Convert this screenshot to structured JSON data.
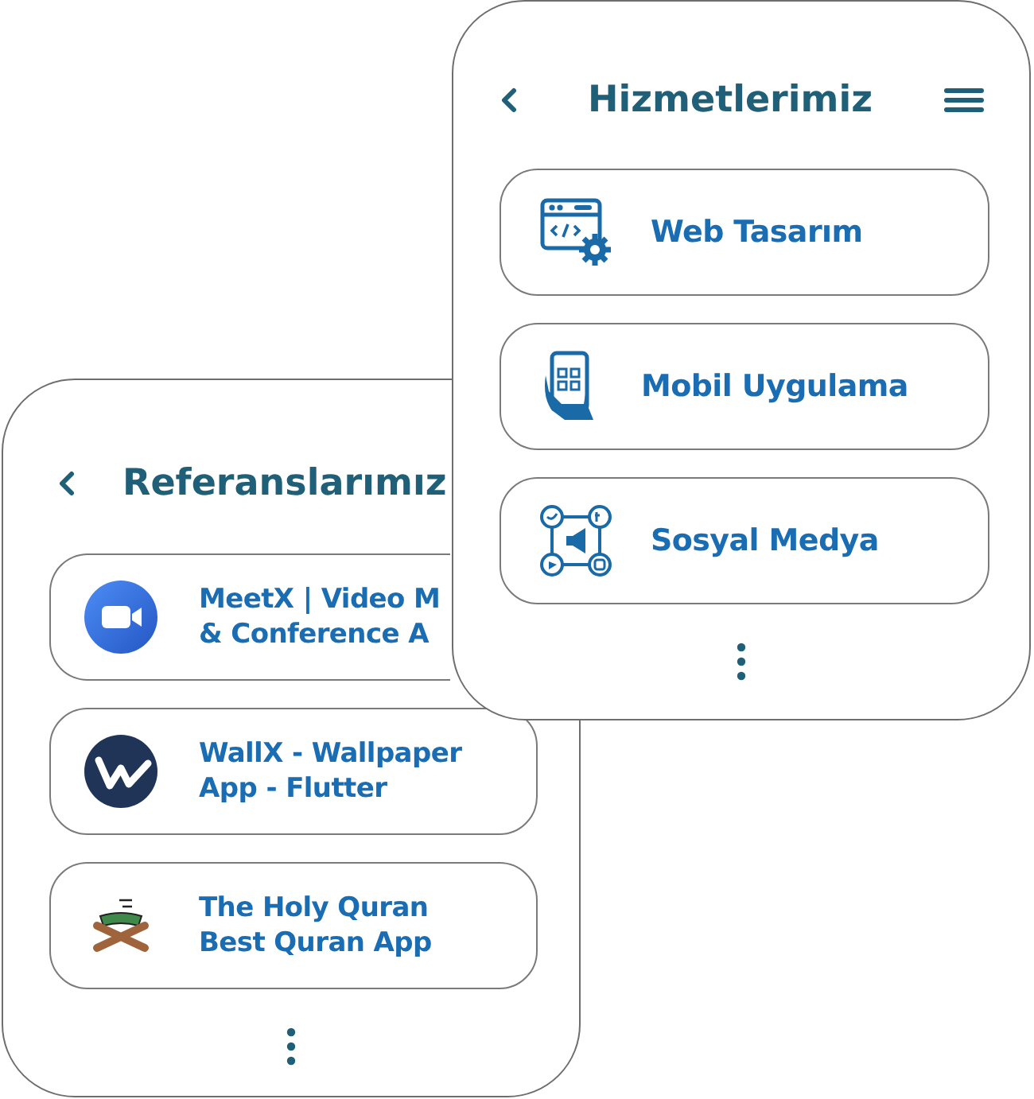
{
  "back_panel": {
    "title": "Referanslarımız",
    "items": [
      {
        "kind": "video",
        "covered": true,
        "lines": [
          "MeetX | Video M",
          "& Conference A"
        ]
      },
      {
        "kind": "w-logo",
        "lines": [
          "WallX - Wallpaper",
          "App - Flutter"
        ]
      },
      {
        "kind": "quran",
        "lines": [
          "The Holy Quran",
          "Best Quran App"
        ]
      }
    ]
  },
  "front_panel": {
    "title": "Hizmetlerimiz",
    "items": [
      {
        "kind": "web",
        "label": "Web Tasarım"
      },
      {
        "kind": "mobile",
        "label": "Mobil Uygulama"
      },
      {
        "kind": "social",
        "label": "Sosyal Medya"
      }
    ]
  }
}
